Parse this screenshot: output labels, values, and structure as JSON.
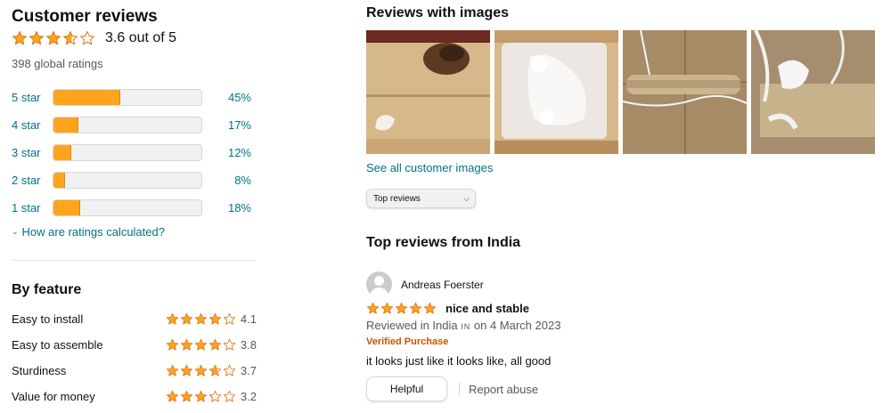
{
  "colors": {
    "star": "#ffa41c",
    "star_stroke": "#de7921",
    "link": "#007185",
    "verified": "#c45500"
  },
  "summary": {
    "title": "Customer reviews",
    "stars": 3.6,
    "rating_text": "3.6 out of 5",
    "global_ratings": "398 global ratings"
  },
  "histogram": [
    {
      "label": "5 star",
      "percent": 45,
      "percent_text": "45%"
    },
    {
      "label": "4 star",
      "percent": 17,
      "percent_text": "17%"
    },
    {
      "label": "3 star",
      "percent": 12,
      "percent_text": "12%"
    },
    {
      "label": "2 star",
      "percent": 8,
      "percent_text": "8%"
    },
    {
      "label": "1 star",
      "percent": 18,
      "percent_text": "18%"
    }
  ],
  "how_calculated": "How are ratings calculated?",
  "by_feature": {
    "title": "By feature",
    "items": [
      {
        "name": "Easy to install",
        "rating": 4.1,
        "value": "4.1"
      },
      {
        "name": "Easy to assemble",
        "rating": 3.8,
        "value": "3.8"
      },
      {
        "name": "Sturdiness",
        "rating": 3.7,
        "value": "3.7"
      },
      {
        "name": "Value for money",
        "rating": 3.2,
        "value": "3.2"
      }
    ]
  },
  "images_section": {
    "title": "Reviews with images",
    "see_all": "See all customer images"
  },
  "sort": {
    "selected": "Top reviews"
  },
  "top_reviews": {
    "title": "Top reviews from India",
    "reviews": [
      {
        "author": "Andreas Foerster",
        "stars": 5,
        "title": "nice and stable",
        "meta_prefix": "Reviewed in India",
        "country_code": "IN",
        "meta_suffix": "on 4 March 2023",
        "verified": "Verified Purchase",
        "body": "it looks just like it looks like, all good",
        "helpful_label": "Helpful",
        "report_label": "Report abuse"
      }
    ]
  }
}
